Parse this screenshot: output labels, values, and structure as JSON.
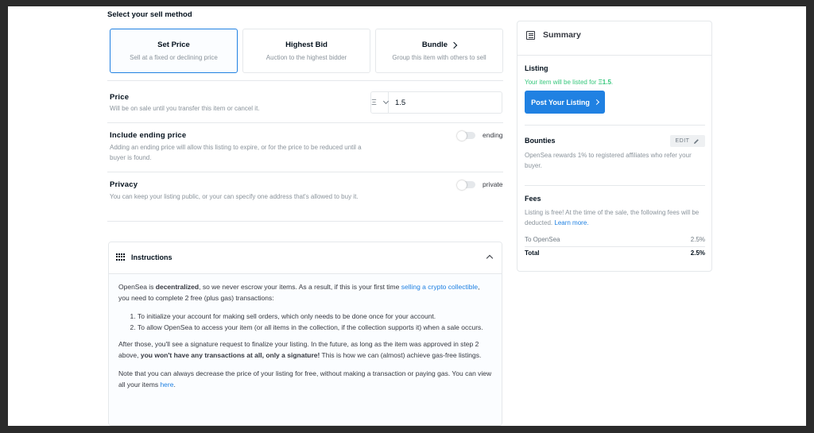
{
  "sell_method": {
    "title": "Select your sell method",
    "options": [
      {
        "label": "Set Price",
        "desc": "Sell at a fixed or declining price",
        "selected": true
      },
      {
        "label": "Highest Bid",
        "desc": "Auction to the highest bidder",
        "selected": false
      },
      {
        "label": "Bundle",
        "desc": "Group this item with others to sell",
        "selected": false
      }
    ]
  },
  "price": {
    "title": "Price",
    "desc": "Will be on sale until you transfer this item or cancel it.",
    "currency": "Ξ",
    "value": "1.5"
  },
  "ending_price": {
    "title": "Include ending price",
    "desc": "Adding an ending price will allow this listing to expire, or for the price to be reduced until a buyer is found.",
    "toggle_label": "ending",
    "enabled": false
  },
  "privacy": {
    "title": "Privacy",
    "desc": "You can keep your listing public, or your can specify one address that's allowed to buy it.",
    "toggle_label": "private",
    "enabled": false
  },
  "instructions": {
    "title": "Instructions",
    "p1_a": "OpenSea is ",
    "p1_b": "decentralized",
    "p1_c": ", so we never escrow your items. As a result, if this is your first time ",
    "p1_link": "selling a crypto collectible",
    "p1_d": ", you need to complete 2 free (plus gas) transactions:",
    "steps": [
      "To initialize your account for making sell orders, which only needs to be done once for your account.",
      "To allow OpenSea to access your item (or all items in the collection, if the collection supports it) when a sale occurs."
    ],
    "p2_a": "After those, you'll see a signature request to finalize your listing. In the future, as long as the item was approved in step 2 above, ",
    "p2_b": "you won't have any transactions at all, only a signature!",
    "p2_c": " This is how we can (almost) achieve gas-free listings.",
    "p3_a": "Note that you can always decrease the price of your listing for free, without making a transaction or paying gas. You can view all your items ",
    "p3_link": "here",
    "p3_b": "."
  },
  "summary": {
    "title": "Summary",
    "listing_label": "Listing",
    "listing_text": "Your item will be listed for ",
    "listing_amount": "Ξ1.5",
    "listing_end": ".",
    "post_button": "Post Your Listing",
    "bounties_label": "Bounties",
    "edit_button": "EDIT",
    "bounties_text": "OpenSea rewards 1% to registered affiliates who refer your buyer.",
    "fees_label": "Fees",
    "fees_text": "Listing is free! At the time of the sale, the following fees will be deducted. ",
    "learn_more": "Learn more.",
    "fees": [
      {
        "name": "To OpenSea",
        "value": "2.5%"
      },
      {
        "name": "Total",
        "value": "2.5%"
      }
    ]
  },
  "colors": {
    "accent": "#2081e2",
    "success": "#34c77b",
    "muted": "#8a939b"
  }
}
